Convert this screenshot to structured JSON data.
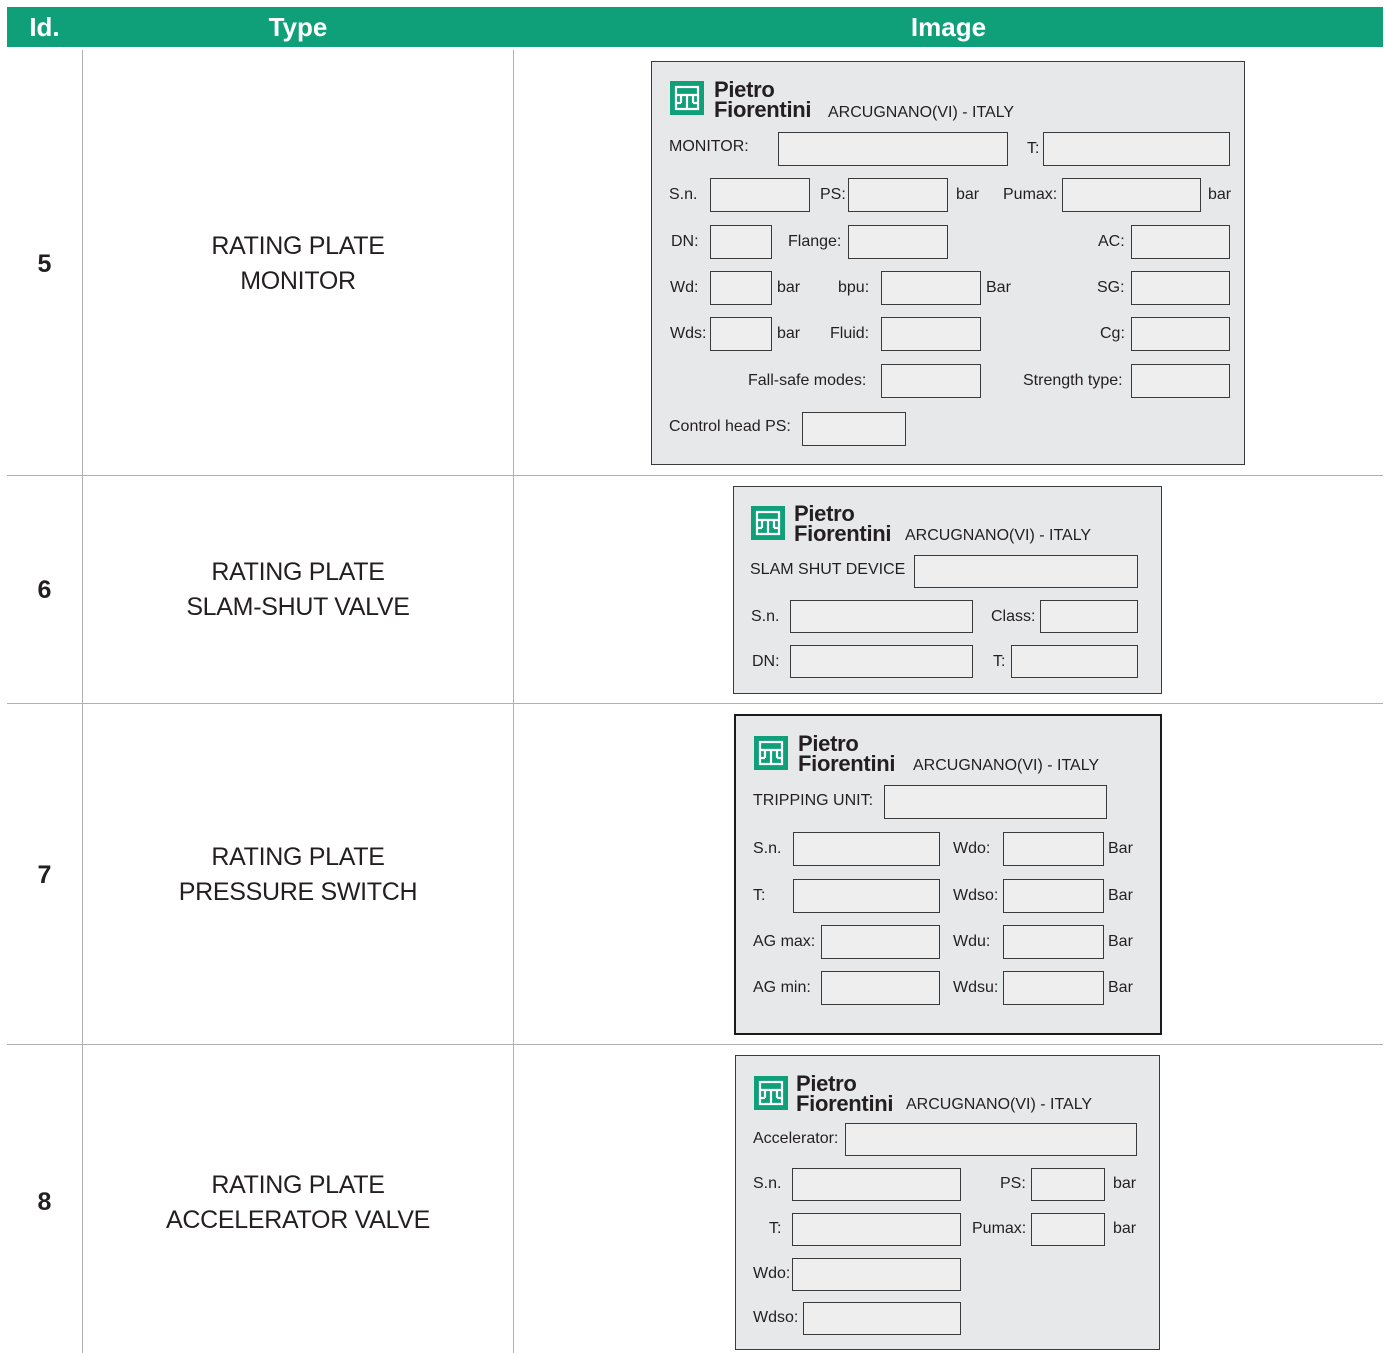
{
  "header": {
    "id": "Id.",
    "type": "Type",
    "image": "Image"
  },
  "brand": {
    "line1": "Pietro",
    "line2": "Fiorentini",
    "location": "ARCUGNANO(VI) - ITALY"
  },
  "rows": [
    {
      "id": "5",
      "type_line1": "RATING PLATE",
      "type_line2": "MONITOR",
      "plate": {
        "title": "MONITOR:",
        "t": "T:",
        "sn": "S.n.",
        "ps": "PS:",
        "bar": "bar",
        "pumax": "Pumax:",
        "dn": "DN:",
        "flange": "Flange:",
        "ac": "AC:",
        "wd": "Wd:",
        "bpu": "bpu:",
        "bar_cap": "Bar",
        "sg": "SG:",
        "wds": "Wds:",
        "fluid": "Fluid:",
        "cg": "Cg:",
        "failsafe": "Fall-safe modes:",
        "strength": "Strength type:",
        "control_head": "Control head PS:"
      }
    },
    {
      "id": "6",
      "type_line1": "RATING PLATE",
      "type_line2": "SLAM-SHUT VALVE",
      "plate": {
        "title": "SLAM SHUT DEVICE",
        "sn": "S.n.",
        "class": "Class:",
        "dn": "DN:",
        "t": "T:"
      }
    },
    {
      "id": "7",
      "type_line1": "RATING PLATE",
      "type_line2": "PRESSURE SWITCH",
      "plate": {
        "title": "TRIPPING UNIT:",
        "sn": "S.n.",
        "wdo": "Wdo:",
        "bar": "Bar",
        "t": "T:",
        "wdso": "Wdso:",
        "agmax": "AG max:",
        "wdu": "Wdu:",
        "agmin": "AG min:",
        "wdsu": "Wdsu:"
      }
    },
    {
      "id": "8",
      "type_line1": "RATING PLATE",
      "type_line2": "ACCELERATOR VALVE",
      "plate": {
        "title": "Accelerator:",
        "sn": "S.n.",
        "ps": "PS:",
        "bar": "bar",
        "t": "T:",
        "pumax": "Pumax:",
        "wdo": "Wdo:",
        "wdso": "Wdso:"
      }
    }
  ],
  "colors": {
    "accent": "#0fa07a",
    "plate_bg": "#e7e8e9",
    "grid": "#b0b0b0"
  },
  "icons": {
    "logo": "pietro-fiorentini-logo-icon"
  }
}
